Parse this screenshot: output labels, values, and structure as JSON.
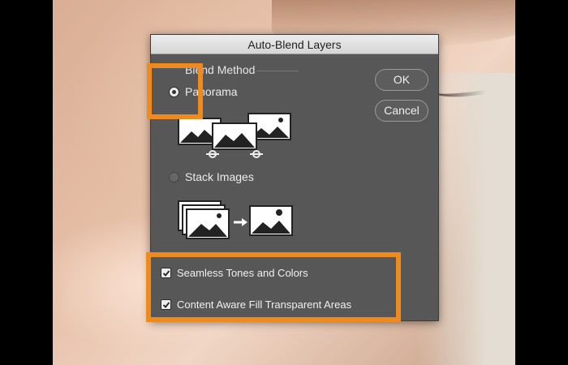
{
  "dialog": {
    "title": "Auto-Blend Layers",
    "group_label": "Blend Method",
    "options": [
      {
        "label": "Panorama",
        "selected": true
      },
      {
        "label": "Stack Images",
        "selected": false
      }
    ],
    "checkboxes": [
      {
        "label": "Seamless Tones and Colors",
        "checked": true
      },
      {
        "label": "Content Aware Fill Transparent Areas",
        "checked": true
      }
    ],
    "buttons": {
      "ok": "OK",
      "cancel": "Cancel"
    }
  },
  "icons": {
    "panorama_illustration": "panorama-illustration",
    "stack_illustration": "stack-images-illustration",
    "check": "check-icon"
  },
  "colors": {
    "dialog_bg": "#575757",
    "highlight": "#ef8a1e",
    "titlebar": "#dcdcdc"
  }
}
